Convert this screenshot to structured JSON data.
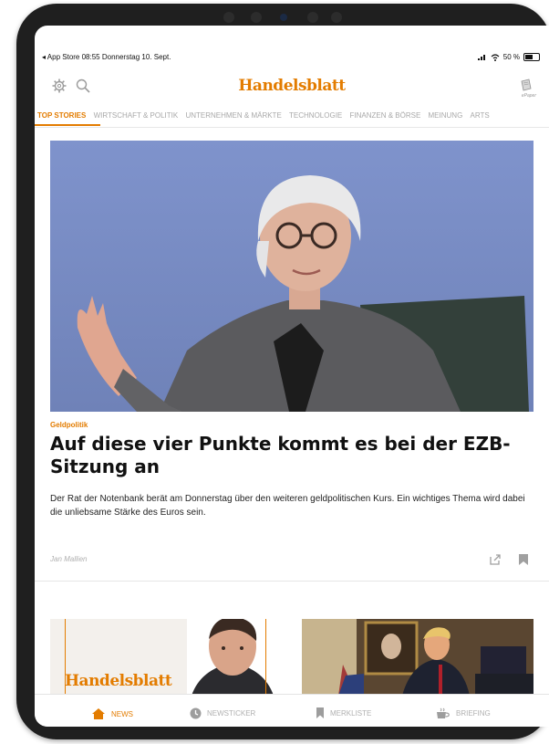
{
  "status_bar": {
    "left_text": "◂ App Store  08:55  Donnerstag 10. Sept.",
    "battery": "50 %"
  },
  "header": {
    "logo": "Handelsblatt",
    "epaper_label": "ePaper"
  },
  "tabs": [
    {
      "label": "TOP STORIES",
      "active": true
    },
    {
      "label": "WIRTSCHAFT & POLITIK"
    },
    {
      "label": "UNTERNEHMEN & MÄRKTE"
    },
    {
      "label": "TECHNOLOGIE"
    },
    {
      "label": "FINANZEN & BÖRSE"
    },
    {
      "label": "MEINUNG"
    },
    {
      "label": "ARTS"
    }
  ],
  "article": {
    "kicker": "Geldpolitik",
    "headline": "Auf diese vier Punkte kommt es bei der EZB-Sitzung an",
    "teaser": "Der Rat der Notenbank berät am Donnerstag über den weiteren geldpolitischen Kurs. Ein wichtiges Thema wird dabei die unliebsame Stärke des Euros sein.",
    "author": "Jan Mallien"
  },
  "cards": {
    "card1_logo": "Handelsblatt"
  },
  "bottom_nav": [
    {
      "label": "NEWS",
      "icon": "house-icon",
      "active": true
    },
    {
      "label": "NEWSTICKER",
      "icon": "clock-icon"
    },
    {
      "label": "MERKLISTE",
      "icon": "bookmark-icon"
    },
    {
      "label": "BRIEFING",
      "icon": "coffee-icon"
    }
  ],
  "colors": {
    "accent": "#e37c00",
    "inactive": "#b0b0b0"
  }
}
